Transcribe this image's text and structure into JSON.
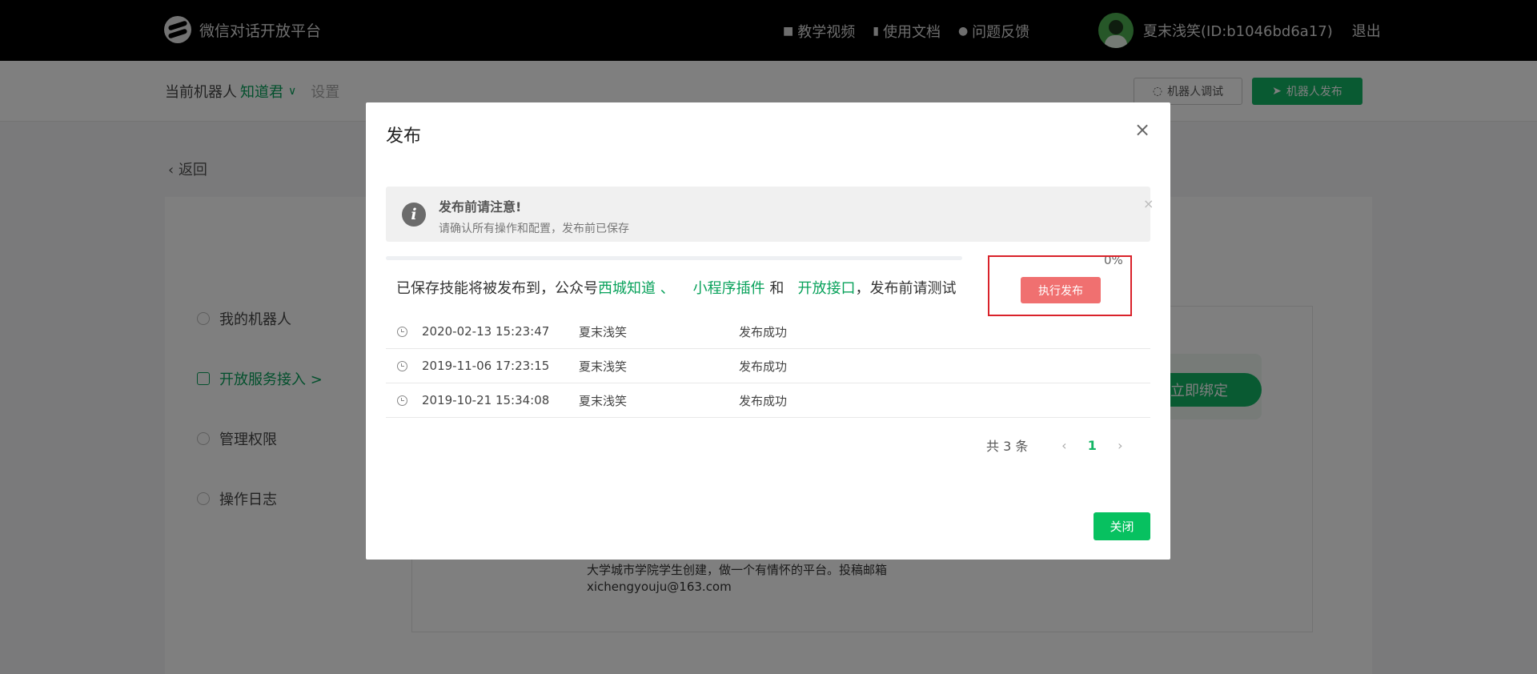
{
  "topbar": {
    "brand": "微信对话开放平台",
    "nav": [
      {
        "label": "教学视频",
        "icon": "video-icon"
      },
      {
        "label": "使用文档",
        "icon": "document-icon"
      },
      {
        "label": "问题反馈",
        "icon": "user-icon"
      }
    ],
    "user_name": "夏末浅笑(ID:b1046bd6a17)",
    "logout": "退出"
  },
  "subheader": {
    "current_bot_label": "当前机器人",
    "bot_name": "知道君",
    "settings": "设置",
    "debug_button": "机器人调试",
    "publish_button": "机器人发布"
  },
  "background": {
    "back_link": "返回",
    "side_menu": [
      "我的机器人",
      "开放服务接入 >",
      "管理权限",
      "操作日志"
    ],
    "bind_button": "立即绑定",
    "description": "大学城市学院学生创建，做一个有情怀的平台。投稿邮箱xichengyouju@163.com"
  },
  "modal": {
    "title": "发布",
    "notice_title": "发布前请注意!",
    "notice_text": "请确认所有操作和配置，发布前已保存",
    "progress_percent": 0,
    "progress_label": "0%",
    "publish_line": {
      "prefix": "已保存技能将被发布到，公众号",
      "target1": "西城知道",
      "sep1": " 、",
      "target2": "小程序插件",
      "and": " 和",
      "target3": "开放接口",
      "suffix": "，发布前请测试"
    },
    "execute_button": "执行发布",
    "history": [
      {
        "time": "2020-02-13 15:23:47",
        "user": "夏末浅笑",
        "status": "发布成功"
      },
      {
        "time": "2019-11-06 17:23:15",
        "user": "夏末浅笑",
        "status": "发布成功"
      },
      {
        "time": "2019-10-21 15:34:08",
        "user": "夏末浅笑",
        "status": "发布成功"
      }
    ],
    "pager": {
      "total": "共 3 条",
      "current_page": "1"
    },
    "close_button": "关闭"
  }
}
